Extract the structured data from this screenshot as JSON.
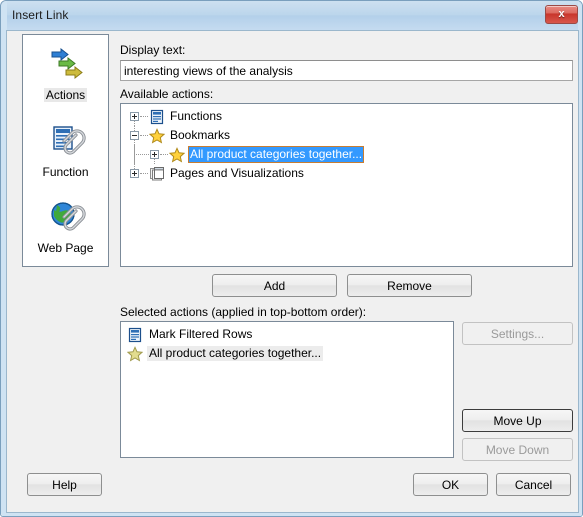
{
  "window": {
    "title": "Insert Link",
    "close_label": "x",
    "close_icon": "close-icon"
  },
  "sidebar": {
    "items": [
      {
        "label": "Actions",
        "icon": "actions-arrows-icon",
        "selected": true
      },
      {
        "label": "Function",
        "icon": "function-document-paperclip-icon",
        "selected": false
      },
      {
        "label": "Web Page",
        "icon": "web-page-globe-paperclip-icon",
        "selected": false
      }
    ]
  },
  "form": {
    "display_text_label": "Display text:",
    "display_text_value": "interesting views of the analysis",
    "display_text_placeholder": "",
    "available_actions_label": "Available actions:",
    "selected_actions_label": "Selected actions (applied in top-bottom order):"
  },
  "available_actions": {
    "nodes": [
      {
        "label": "Functions",
        "icon": "document-lines-icon",
        "depth": 0,
        "expander": "plus"
      },
      {
        "label": "Bookmarks",
        "icon": "star-icon",
        "depth": 0,
        "expander": "minus"
      },
      {
        "label": "All product categories together...",
        "icon": "star-icon",
        "depth": 1,
        "expander": "plus",
        "selected": true
      },
      {
        "label": "Pages and Visualizations",
        "icon": "pages-stack-icon",
        "depth": 0,
        "expander": "plus"
      }
    ]
  },
  "selected_actions": {
    "items": [
      {
        "label": "Mark Filtered Rows",
        "icon": "document-lines-icon",
        "highlighted": false
      },
      {
        "label": "All product categories together...",
        "icon": "star-icon",
        "highlighted": true
      }
    ]
  },
  "buttons": {
    "add": "Add",
    "remove": "Remove",
    "settings": "Settings...",
    "move_up": "Move Up",
    "move_down": "Move Down",
    "help": "Help",
    "ok": "OK",
    "cancel": "Cancel"
  },
  "colors": {
    "selection_blue": "#3399ff",
    "selection_border": "#c87d32",
    "titlebar_blue": "#bcd6ec",
    "frame_blue": "#cfe3f3",
    "dialog_face": "#f0f0f0",
    "close_red": "#c8352b",
    "disabled_text": "#9a9a9a"
  }
}
